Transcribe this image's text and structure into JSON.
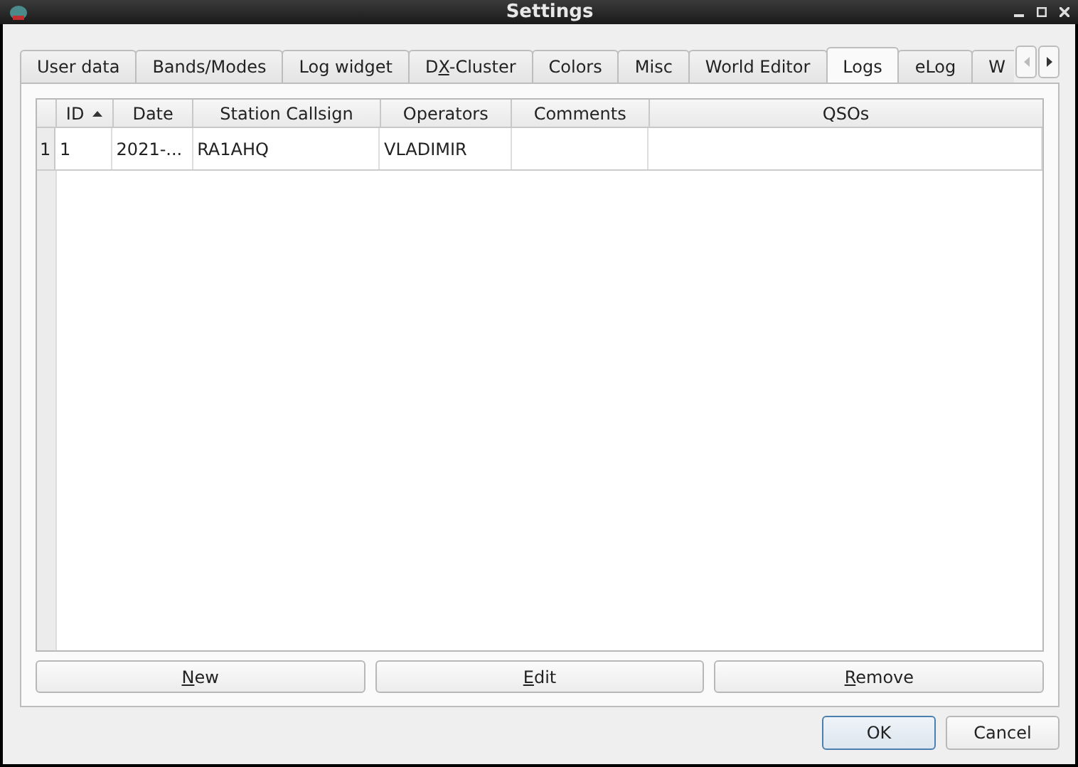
{
  "window": {
    "title": "Settings"
  },
  "tabs": [
    {
      "label": "User data",
      "selected": false
    },
    {
      "label": "Bands/Modes",
      "selected": false
    },
    {
      "label": "Log widget",
      "selected": false
    },
    {
      "pre": "D",
      "key": "X",
      "post": "-Cluster",
      "selected": false
    },
    {
      "label": "Colors",
      "selected": false
    },
    {
      "label": "Misc",
      "selected": false
    },
    {
      "label": "World Editor",
      "selected": false
    },
    {
      "label": "Logs",
      "selected": true
    },
    {
      "label": "eLog",
      "selected": false
    },
    {
      "label": "W",
      "selected": false
    }
  ],
  "table": {
    "columns": [
      {
        "label": "ID",
        "sorted": true
      },
      {
        "label": "Date",
        "sorted": false
      },
      {
        "label": "Station Callsign",
        "sorted": false
      },
      {
        "label": "Operators",
        "sorted": false
      },
      {
        "label": "Comments",
        "sorted": false
      },
      {
        "label": "QSOs",
        "sorted": false
      }
    ],
    "rows": [
      {
        "number": "1",
        "cells": [
          "1",
          "2021-...",
          "RA1AHQ",
          "VLADIMIR"
        ]
      }
    ]
  },
  "actions": [
    {
      "key": "N",
      "post": "ew"
    },
    {
      "key": "E",
      "post": "dit"
    },
    {
      "key": "R",
      "post": "emove"
    }
  ],
  "dialog_buttons": [
    {
      "label": "OK",
      "default": true
    },
    {
      "label": "Cancel",
      "default": false
    }
  ]
}
